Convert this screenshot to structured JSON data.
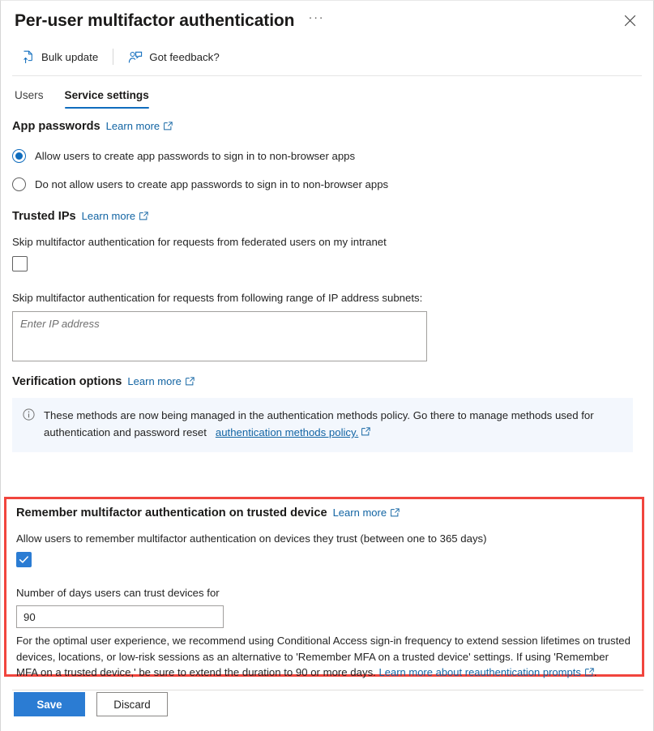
{
  "window": {
    "title": "Per-user multifactor authentication",
    "more_actions_label": "···",
    "close_label": "Close"
  },
  "commandbar": {
    "items": [
      {
        "label": "Bulk update",
        "icon": "bulk-update-icon"
      },
      {
        "label": "Got feedback?",
        "icon": "feedback-icon"
      }
    ]
  },
  "tabs": [
    {
      "label": "Users",
      "active": false
    },
    {
      "label": "Service settings",
      "active": true
    }
  ],
  "learn_more_label": "Learn more",
  "sections": {
    "app_passwords": {
      "heading": "App passwords",
      "learn_more": "Learn more",
      "options": [
        {
          "label": "Allow users to create app passwords to sign in to non-browser apps",
          "selected": true
        },
        {
          "label": "Do not allow users to create app passwords to sign in to non-browser apps",
          "selected": false
        }
      ]
    },
    "trusted_ips": {
      "heading": "Trusted IPs",
      "learn_more": "Learn more",
      "federated_checkbox_label": "Skip multifactor authentication for requests from federated users on my intranet",
      "federated_checked": false,
      "subnets_label": "Skip multifactor authentication for requests from following range of IP address subnets:",
      "subnets_value": "",
      "subnets_placeholder": "Enter IP address"
    },
    "verification_options": {
      "heading": "Verification options",
      "learn_more": "Learn more",
      "banner_icon": "info-icon",
      "banner_text": "These methods are now being managed in the authentication methods policy. Go there to manage methods used for authentication and password reset",
      "banner_link": "authentication methods policy."
    },
    "remember_mfa": {
      "heading": "Remember multifactor authentication on trusted device",
      "learn_more": "Learn more",
      "allow_label": "Allow users to remember multifactor authentication on devices they trust (between one to 365 days)",
      "allow_checked": true,
      "days_label": "Number of days users can trust devices for",
      "days_value": "90",
      "note_text_1": "For the optimal user experience, we recommend using Conditional Access sign-in frequency to extend session lifetimes on trusted devices, locations, or low-risk sessions as an alternative to 'Remember MFA on a trusted device' settings. If using 'Remember MFA on a trusted device,' be sure to extend the duration to 90 or more days.",
      "note_link": "Learn more about reauthentication prompts",
      "note_text_2": "."
    }
  },
  "footer": {
    "save_label": "Save",
    "discard_label": "Discard"
  },
  "colors": {
    "accent": "#0f6cbd",
    "primary_button": "#2b7cd3",
    "link": "#1264a3",
    "highlight_border": "#f1453d",
    "banner_background": "#f3f7fd"
  }
}
